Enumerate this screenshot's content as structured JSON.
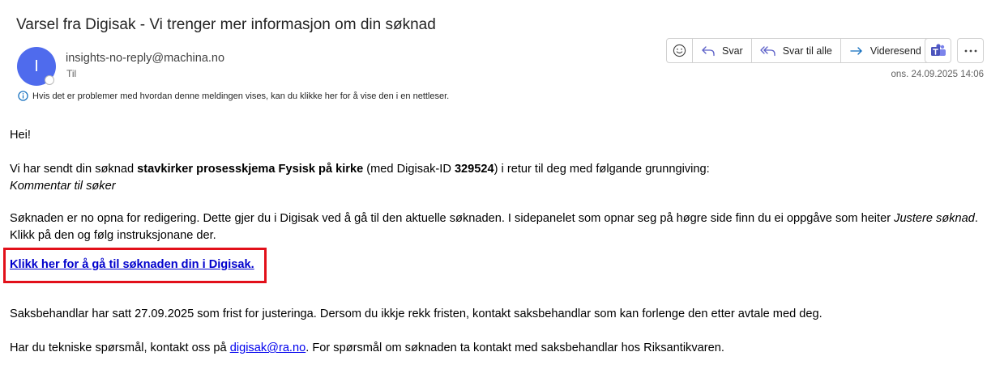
{
  "email": {
    "subject": "Varsel fra Digisak - Vi trenger mer informasjon om din søknad",
    "avatar_initial": "I",
    "sender": "insights-no-reply@machina.no",
    "to_label": "Til",
    "info_line": "Hvis det er problemer med hvordan denne meldingen vises, kan du klikke her for å vise den i en nettleser.",
    "date": "ons. 24.09.2025 14:06"
  },
  "toolbar": {
    "reply_label": "Svar",
    "reply_all_label": "Svar til alle",
    "forward_label": "Videresend"
  },
  "icons": {
    "emoji": "smiley-icon",
    "reply": "reply-arrow-icon",
    "reply_all": "reply-all-arrow-icon",
    "forward": "forward-arrow-icon",
    "teams": "teams-icon",
    "more": "more-dots-icon",
    "info": "info-icon"
  },
  "colors": {
    "avatar": "#4f6bed",
    "accent": "#5b5fc7",
    "link": "#0000ee",
    "highlight": "#e2101a"
  },
  "body": {
    "greeting": "Hei!",
    "intro_pre": "Vi har sendt din søknad ",
    "application_name": "stavkirker prosesskjema Fysisk på kirke",
    "intro_mid": " (med Digisak-ID ",
    "digisak_id": "329524",
    "intro_post": ") i retur til deg med følgande grunngiving:",
    "comment": "Kommentar til søker",
    "edit_pre": "Søknaden er no opna for redigering. Dette gjer du i Digisak ved å gå til den aktuelle søknaden. I sidepanelet som opnar seg på høgre side finn du ei oppgåve som heiter ",
    "edit_task": "Justere søknad",
    "edit_post": ". Klikk på den og følg instruksjonane der.",
    "main_link": "Klikk her for å gå til søknaden din i Digisak.",
    "deadline_pre": "Saksbehandlar har satt ",
    "deadline_date": "27.09.2025",
    "deadline_post": " som frist for justeringa. Dersom du ikkje rekk fristen, kontakt saksbehandlar som kan forlenge den etter avtale med deg.",
    "contact_pre": "Har du tekniske spørsmål, kontakt oss på ",
    "contact_email": "digisak@ra.no",
    "contact_post": ". For spørsmål om søknaden ta kontakt med saksbehandlar hos Riksantikvaren."
  }
}
